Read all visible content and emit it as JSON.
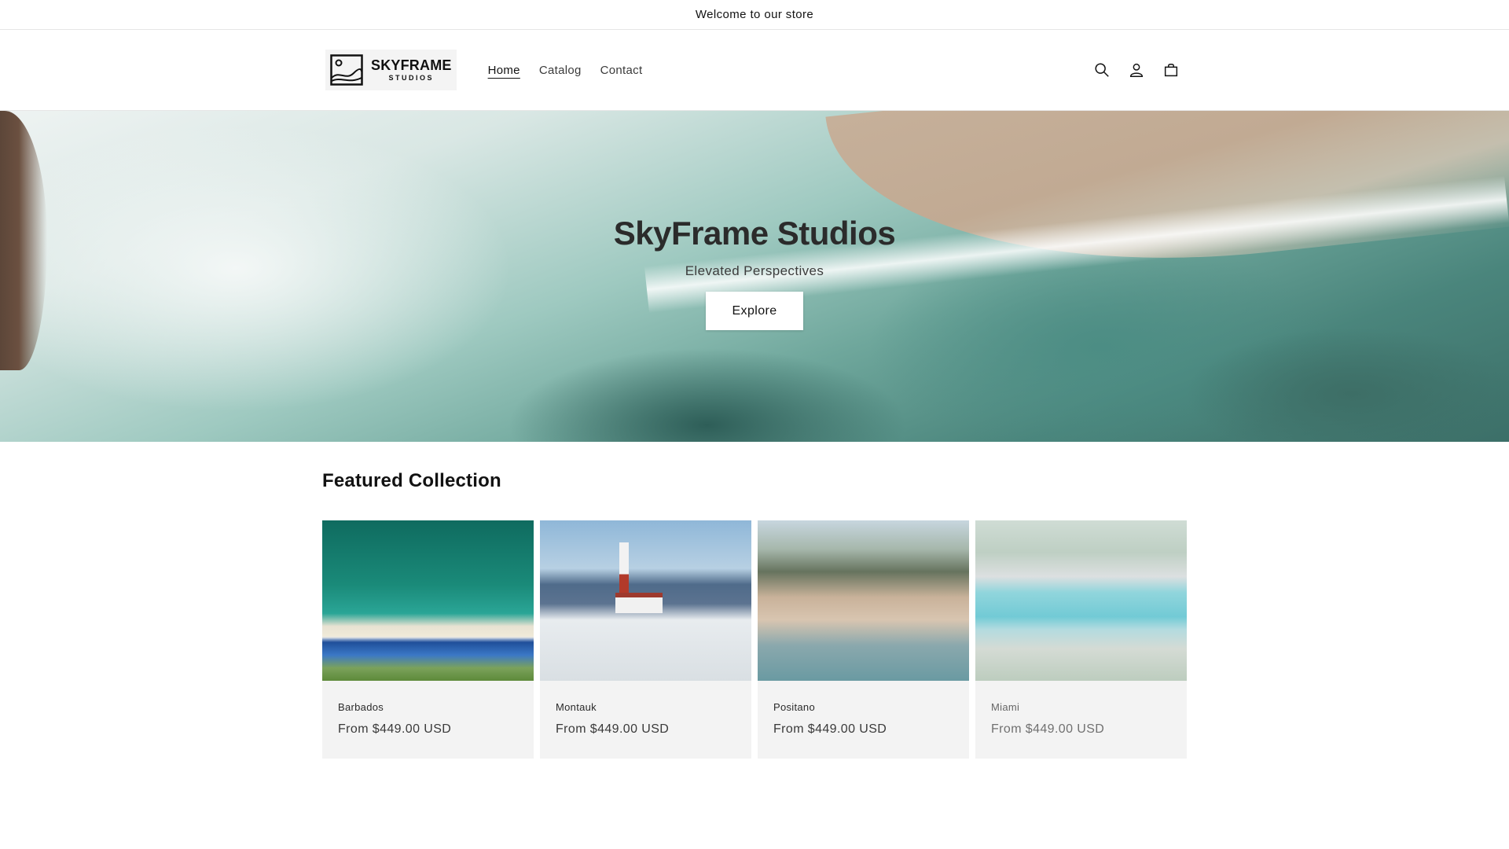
{
  "announcement": {
    "text": "Welcome to our store"
  },
  "header": {
    "logo": {
      "title": "SKYFRAME",
      "subtitle": "STUDIOS"
    },
    "nav": [
      {
        "label": "Home",
        "active": true
      },
      {
        "label": "Catalog",
        "active": false
      },
      {
        "label": "Contact",
        "active": false
      }
    ],
    "icons": [
      "search-icon",
      "account-icon",
      "cart-icon"
    ]
  },
  "hero": {
    "title": "SkyFrame Studios",
    "subtitle": "Elevated Perspectives",
    "button_label": "Explore"
  },
  "featured": {
    "title": "Featured Collection",
    "products": [
      {
        "name": "Barbados",
        "price": "From $449.00 USD"
      },
      {
        "name": "Montauk",
        "price": "From $449.00 USD"
      },
      {
        "name": "Positano",
        "price": "From $449.00 USD"
      },
      {
        "name": "Miami",
        "price": "From $449.00 USD"
      }
    ]
  }
}
